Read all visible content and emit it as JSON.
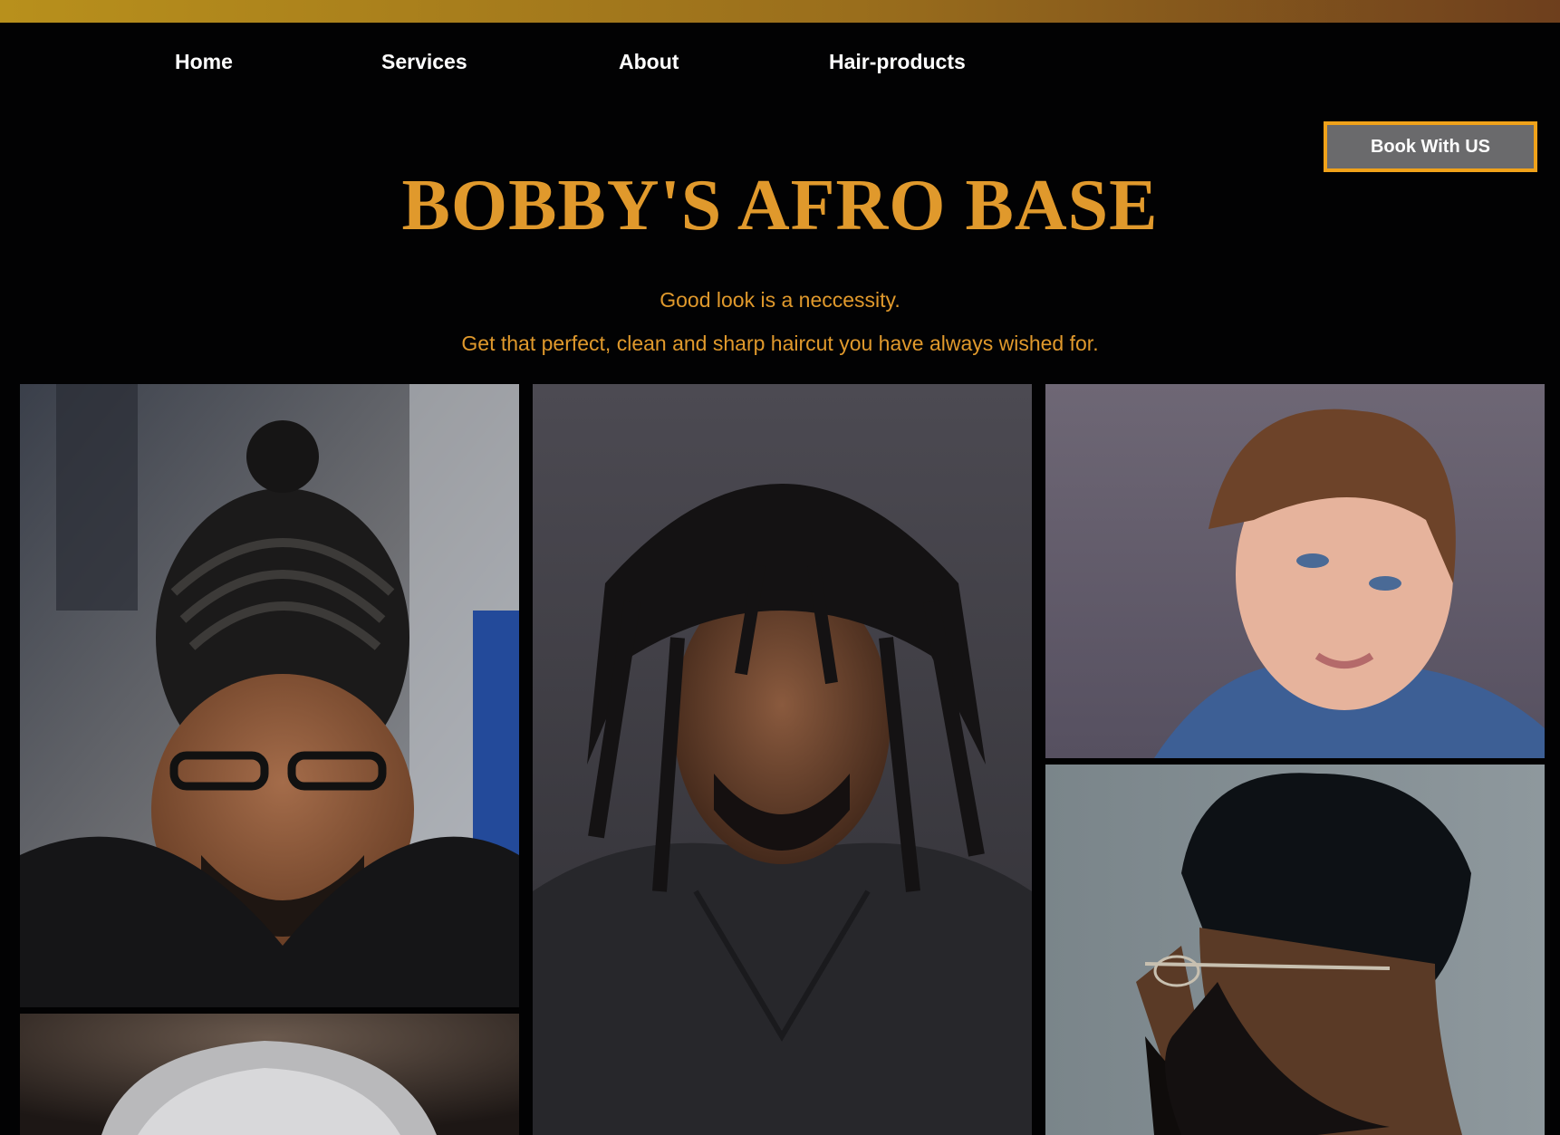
{
  "nav": {
    "items": [
      {
        "label": "Home"
      },
      {
        "label": "Services"
      },
      {
        "label": "About"
      },
      {
        "label": "Hair-products"
      }
    ]
  },
  "cta": {
    "label": "Book With US"
  },
  "hero": {
    "title": "BOBBY'S AFRO BASE",
    "tagline_1": "Good look is a neccessity.",
    "tagline_2": "Get that perfect, clean and sharp haircut you have always wished for."
  },
  "colors": {
    "background": "#020203",
    "accent": "#e0992c",
    "button_border": "#f0a21a",
    "button_fill": "#6a6a6c",
    "top_bar_start": "#b8901c",
    "top_bar_end": "#6e3f1d"
  },
  "gallery": {
    "photos": [
      {
        "subject": "braided-hairstyle-man-with-glasses"
      },
      {
        "subject": "man-with-dreadlocks"
      },
      {
        "subject": "man-with-side-swept-hair"
      },
      {
        "subject": "man-with-high-top-fade-and-beard"
      },
      {
        "subject": "grey-textured-hair"
      }
    ]
  }
}
